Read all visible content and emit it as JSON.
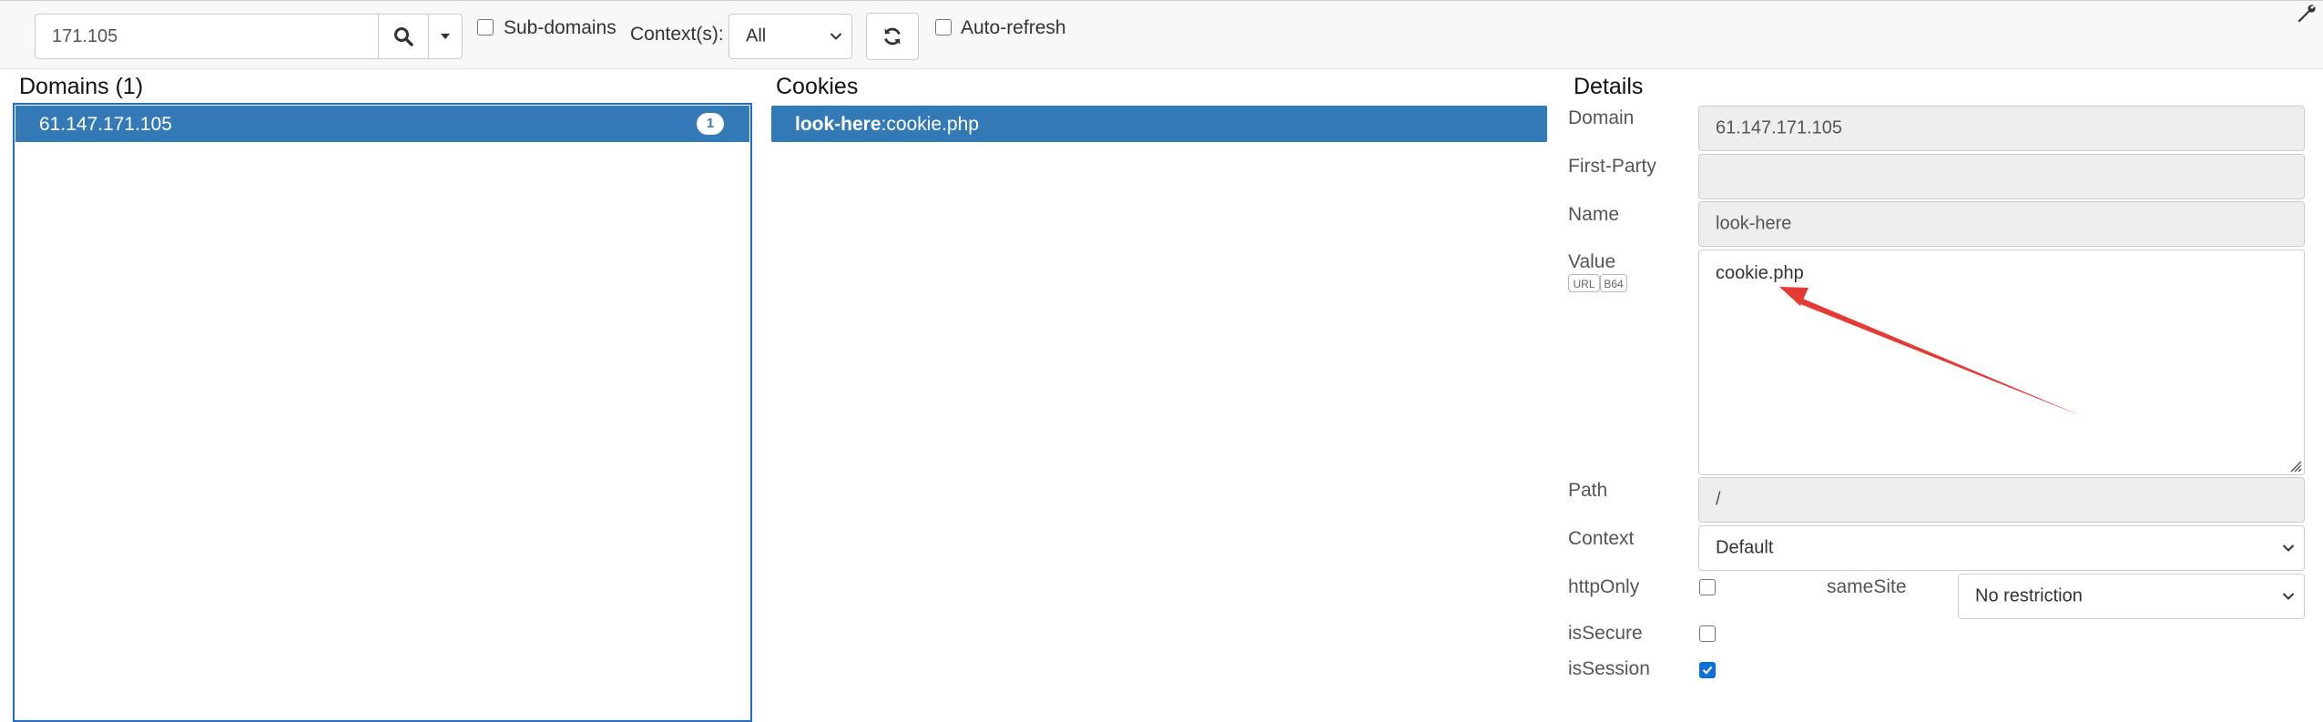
{
  "toolbar": {
    "search_value": "171.105",
    "subdomains_label": "Sub-domains",
    "subdomains_checked": false,
    "contexts_label": "Context(s):",
    "contexts_value": "All",
    "autorefresh_label": "Auto-refresh",
    "autorefresh_checked": false,
    "icons": [
      "search-icon",
      "caret-down-icon",
      "chevron-down-icon",
      "refresh-icon",
      "wrench-icon"
    ]
  },
  "domains": {
    "title": "Domains (1)",
    "items": [
      {
        "name": "61.147.171.105",
        "count": "1"
      }
    ]
  },
  "cookies": {
    "title": "Cookies",
    "items": [
      {
        "name": "look-here",
        "separator": ":",
        "value": "cookie.php"
      }
    ]
  },
  "details": {
    "title": "Details",
    "domain_label": "Domain",
    "domain_value": "61.147.171.105",
    "first_party_label": "First-Party",
    "first_party_value": "",
    "name_label": "Name",
    "name_value": "look-here",
    "value_label": "Value",
    "url_button": "URL",
    "b64_button": "B64",
    "value_value": "cookie.php",
    "path_label": "Path",
    "path_value": "/",
    "context_label": "Context",
    "context_value": "Default",
    "httponly_label": "httpOnly",
    "httponly_checked": false,
    "samesite_label": "sameSite",
    "samesite_value": "No restriction",
    "issecure_label": "isSecure",
    "issecure_checked": false,
    "issession_label": "isSession",
    "issession_checked": true
  },
  "colors": {
    "selection": "#337ab7",
    "focus_border": "#1f6fd1",
    "checkbox_checked": "#0b6fd6",
    "annotation_arrow": "#e53935"
  }
}
